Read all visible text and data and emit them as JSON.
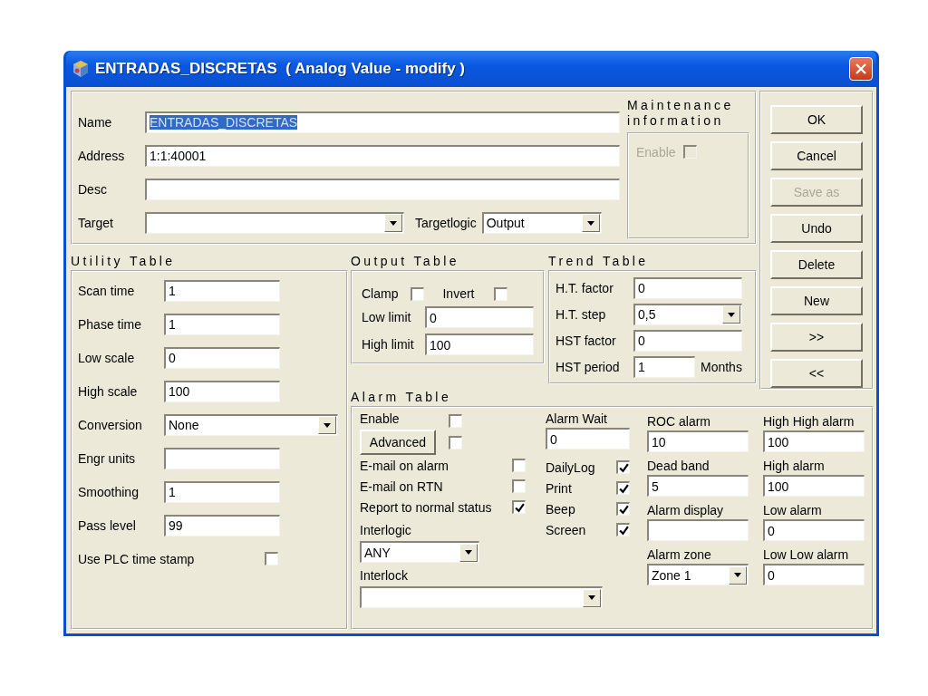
{
  "window": {
    "title": "ENTRADAS_DISCRETAS  ( Analog Value - modify )"
  },
  "header": {
    "fields": [
      {
        "label": "Name",
        "value": "ENTRADAS_DISCRETAS",
        "highlighted": true
      },
      {
        "label": "Address",
        "value": "1:1:40001",
        "highlighted": false
      },
      {
        "label": "Desc"
      }
    ],
    "target": {
      "label": "Target"
    },
    "targetlogic": {
      "label": "Targetlogic",
      "value": "Output"
    }
  },
  "maintenance": {
    "title": "Maintenance information",
    "enable": {
      "label": "Enable",
      "checked": false,
      "disabled": true
    }
  },
  "buttons": [
    {
      "label": "OK",
      "disabled": false
    },
    {
      "label": "Cancel",
      "disabled": false
    },
    {
      "label": "Save as",
      "disabled": true
    },
    {
      "label": "Undo",
      "disabled": false
    },
    {
      "label": "Delete",
      "disabled": false
    },
    {
      "label": "New",
      "disabled": false
    },
    {
      "label": ">>",
      "disabled": false
    },
    {
      "label": "<<",
      "disabled": false
    }
  ],
  "utility_table": {
    "title": "Utility Table",
    "fields": [
      {
        "kind": "text",
        "label": "Scan time",
        "value": "1"
      },
      {
        "kind": "text",
        "label": "Phase time",
        "value": "1"
      },
      {
        "kind": "text",
        "label": "Low scale",
        "value": "0"
      },
      {
        "kind": "text",
        "label": "High scale",
        "value": "100"
      },
      {
        "kind": "select",
        "label": "Conversion",
        "value": "None"
      },
      {
        "kind": "text",
        "label": "Engr units"
      },
      {
        "kind": "text",
        "label": "Smoothing",
        "value": "1"
      },
      {
        "kind": "text",
        "label": "Pass level",
        "value": "99"
      },
      {
        "kind": "checkbox",
        "label": "Use PLC time stamp",
        "checked": false
      }
    ]
  },
  "output_table": {
    "title": "Output Table",
    "checks": [
      {
        "label": "Clamp",
        "checked": false
      },
      {
        "label": "Invert",
        "checked": false
      }
    ],
    "fields": [
      {
        "label": "Low limit",
        "value": "0"
      },
      {
        "label": "High limit",
        "value": "100"
      }
    ]
  },
  "trend_table": {
    "title": "Trend Table",
    "fields": [
      {
        "kind": "text",
        "label": "H.T. factor",
        "value": "0"
      },
      {
        "kind": "select",
        "label": "H.T. step",
        "value": "0,5"
      },
      {
        "kind": "text",
        "label": "HST factor",
        "value": "0"
      },
      {
        "kind": "text",
        "label": "HST period",
        "value": "1",
        "unit": "Months"
      }
    ]
  },
  "alarm_table": {
    "title": "Alarm Table",
    "enable": {
      "label": "Enable",
      "checked": false
    },
    "advanced": {
      "label": "Advanced",
      "checked": false
    },
    "options": [
      {
        "label": "E-mail on alarm",
        "checked": false
      },
      {
        "label": "E-mail on RTN",
        "checked": false
      },
      {
        "label": "Report to normal status",
        "checked": true
      }
    ],
    "interlogic": {
      "label": "Interlogic",
      "value": "ANY"
    },
    "interlock": {
      "label": "Interlock"
    },
    "alarm_wait": {
      "label": "Alarm Wait",
      "value": "0"
    },
    "outputs": [
      {
        "label": "DailyLog",
        "checked": true
      },
      {
        "label": "Print",
        "checked": true
      },
      {
        "label": "Beep",
        "checked": true
      },
      {
        "label": "Screen",
        "checked": true
      }
    ],
    "rate_fields": [
      {
        "kind": "text",
        "label": "ROC alarm",
        "value": "10"
      },
      {
        "kind": "text",
        "label": "Dead band",
        "value": "5"
      },
      {
        "kind": "text",
        "label": "Alarm display"
      },
      {
        "kind": "select",
        "label": "Alarm zone",
        "value": "Zone 1"
      }
    ],
    "limit_fields": [
      {
        "kind": "text",
        "label": "High High alarm",
        "value": "100"
      },
      {
        "kind": "text",
        "label": "High alarm",
        "value": "100"
      },
      {
        "kind": "text",
        "label": "Low alarm",
        "value": "0"
      },
      {
        "kind": "text",
        "label": "Low Low alarm",
        "value": "0"
      }
    ]
  }
}
